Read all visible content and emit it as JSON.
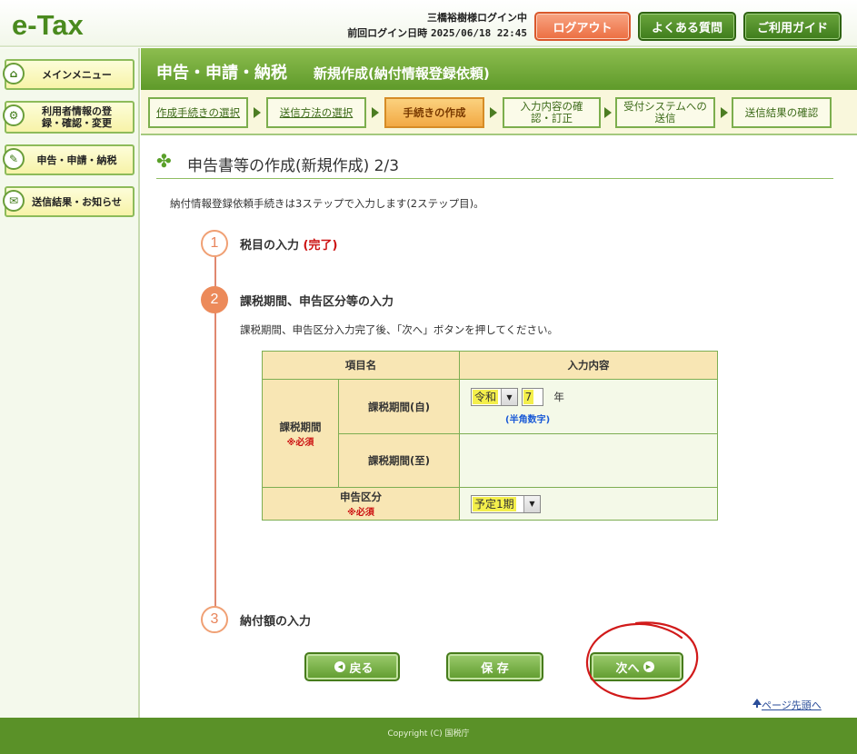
{
  "header": {
    "logo": "e-Tax",
    "user_line": "三橋裕樹様ログイン中",
    "last_login_label": "前回ログイン日時",
    "last_login_value": "2025/06/18 22:45",
    "logout_label": "ログアウト",
    "faq_label": "よくある質問",
    "guide_label": "ご利用ガイド"
  },
  "sidebar": {
    "items": [
      {
        "label": "メインメニュー",
        "icon": "home-icon"
      },
      {
        "label": "利用者情報の登録・確認・変更",
        "icon": "user-settings-icon"
      },
      {
        "label": "申告・申請・納税",
        "icon": "document-icon"
      },
      {
        "label": "送信結果・お知らせ",
        "icon": "mail-icon"
      }
    ]
  },
  "title_bar": {
    "main": "申告・申請・納税",
    "sub": "新規作成(納付情報登録依頼)"
  },
  "steps": [
    {
      "label": "作成手続きの選択",
      "state": "link"
    },
    {
      "label": "送信方法の選択",
      "state": "link"
    },
    {
      "label": "手続きの作成",
      "state": "current"
    },
    {
      "label": "入力内容の確認・訂正",
      "state": "pending"
    },
    {
      "label": "受付システムへの送信",
      "state": "pending"
    },
    {
      "label": "送信結果の確認",
      "state": "pending"
    }
  ],
  "content": {
    "heading": "申告書等の作成(新規作成) 2/3",
    "intro": "納付情報登録依頼手続きは3ステップで入力します(2ステップ目)。",
    "step1": {
      "num": "1",
      "label": "税目の入力",
      "status": "(完了)"
    },
    "step2": {
      "num": "2",
      "label": "課税期間、申告区分等の入力",
      "note": "課税期間、申告区分入力完了後、「次へ」ボタンを押してください。"
    },
    "step3": {
      "num": "3",
      "label": "納付額の入力"
    }
  },
  "table": {
    "col_item": "項目名",
    "col_input": "入力内容",
    "group_label": "課税期間",
    "required": "※必須",
    "start_label": "課税期間(自)",
    "era_value": "令和",
    "year_value": "7",
    "year_unit": "年",
    "hankaku_note": "(半角数字)",
    "end_label": "課税期間(至)",
    "kubun_label": "申告区分",
    "kubun_value": "予定1期"
  },
  "buttons": {
    "back": "戻る",
    "save": "保 存",
    "next": "次へ"
  },
  "page_top": "ページ先頭へ",
  "footer": {
    "copyright": "Copyright (C) 国税庁"
  },
  "colors": {
    "brand_green": "#5f9a2a",
    "logout_orange": "#ec6e41",
    "current_step_orange": "#f2a944",
    "annotation_red": "#d11a1a"
  }
}
